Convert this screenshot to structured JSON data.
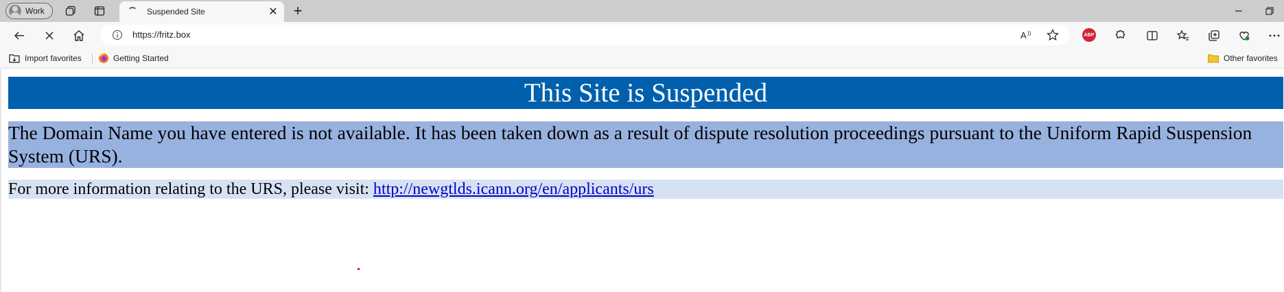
{
  "browser": {
    "profile_label": "Work",
    "tab_title": "Suspended Site",
    "url": "https://fritz.box",
    "extension_label": "ABP",
    "favorites": {
      "import_label": "Import favorites",
      "getting_started_label": "Getting Started",
      "other_label": "Other favorites"
    }
  },
  "page": {
    "banner_title": "This Site is Suspended",
    "notice_text": "The Domain Name you have entered is not available. It has been taken down as a result of dispute resolution proceedings pursuant to the Uniform Rapid Suspension System (URS).",
    "info_prefix": "For more information relating to the URS, please visit: ",
    "info_link": "http://newgtlds.icann.org/en/applicants/urs"
  },
  "colors": {
    "banner_bg": "#0060ae",
    "notice_bg": "#98b2e0",
    "info_bg": "#d6e2f4",
    "link": "#0000cc"
  }
}
